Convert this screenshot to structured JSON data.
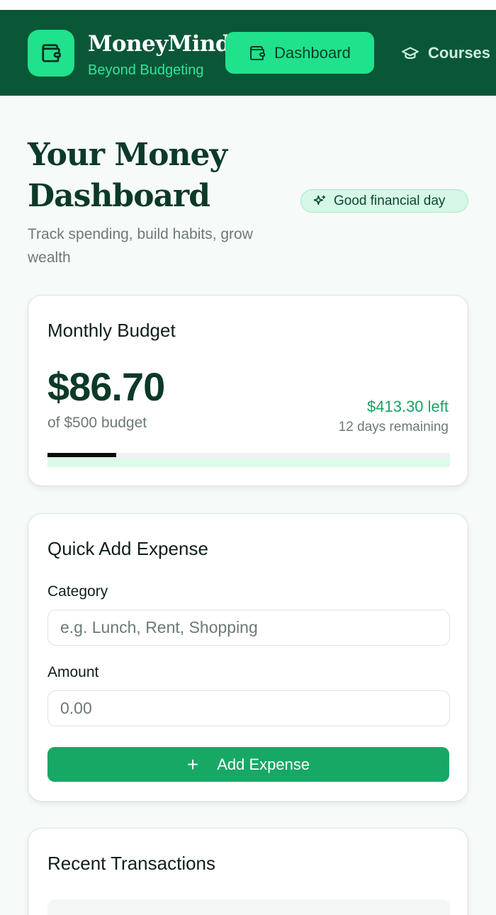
{
  "header": {
    "brand_name": "MoneyMind",
    "brand_tagline": "Beyond Budgeting",
    "nav": [
      {
        "label": "Dashboard",
        "icon": "wallet-icon",
        "active": true
      },
      {
        "label": "Courses",
        "icon": "graduation-cap-icon",
        "active": false
      }
    ]
  },
  "page": {
    "title": "Your Money Dashboard",
    "subtitle": "Track spending, build habits, grow wealth",
    "badge": {
      "label": "Good financial day",
      "icon": "sparkles-icon"
    }
  },
  "budget": {
    "title": "Monthly Budget",
    "spent": "$86.70",
    "of_budget": "of $500 budget",
    "left": "$413.30 left",
    "days_remaining": "12 days remaining",
    "progress_fraction": 0.17
  },
  "quick_add": {
    "title": "Quick Add Expense",
    "category_label": "Category",
    "category_placeholder": "e.g. Lunch, Rent, Shopping",
    "amount_label": "Amount",
    "amount_placeholder": "0.00",
    "button_label": "Add Expense"
  },
  "transactions": {
    "title": "Recent Transactions"
  },
  "colors": {
    "header_bg": "#0a5738",
    "accent": "#20e18c",
    "primary_button": "#17a866",
    "positive_text": "#17a463"
  }
}
